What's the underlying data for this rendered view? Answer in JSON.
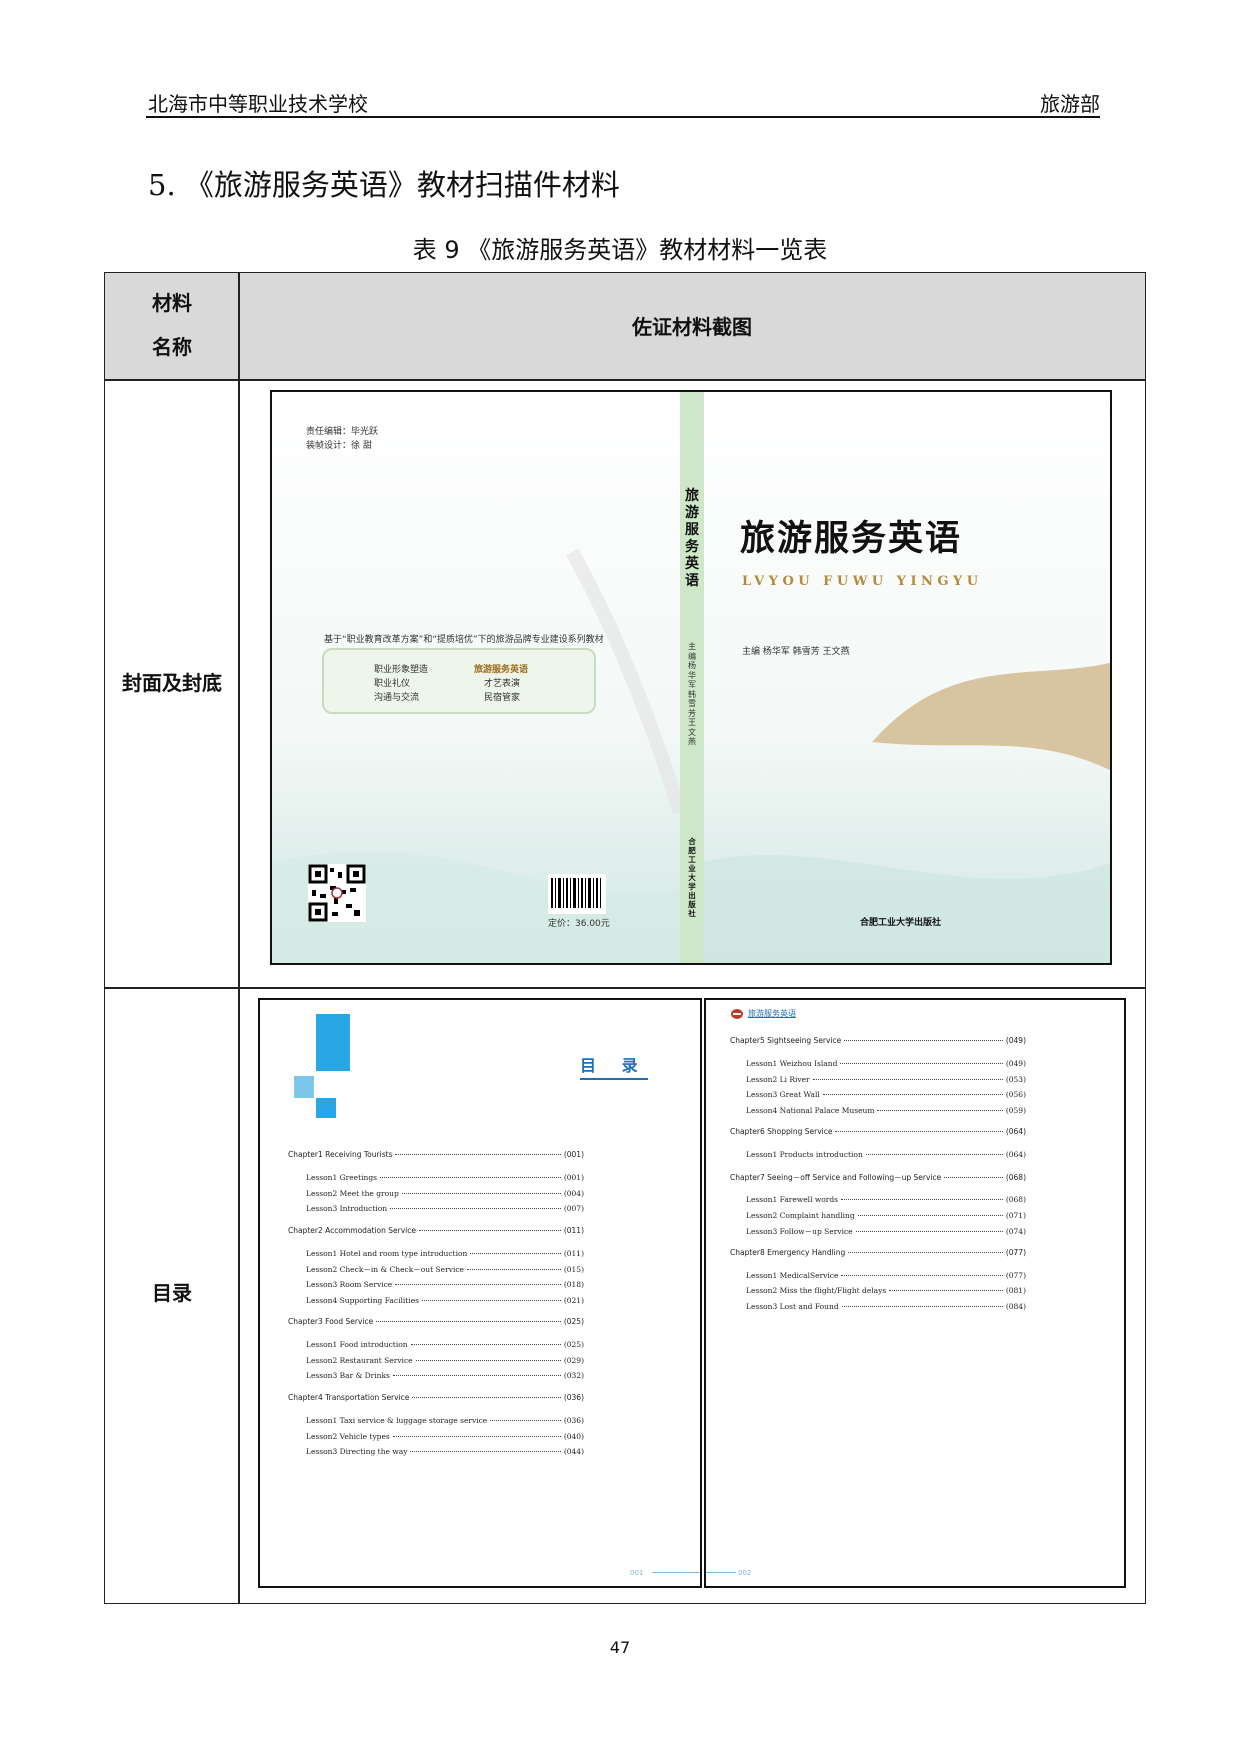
{
  "header": {
    "school": "北海市中等职业技术学校",
    "department": "旅游部"
  },
  "section_heading": "5. 《旅游服务英语》教材扫描件材料",
  "table_caption": "表 9 《旅游服务英语》教材材料一览表",
  "table": {
    "header_col1_line1": "材料",
    "header_col1_line2": "名称",
    "header_col2": "佐证材料截图",
    "rows": [
      {
        "name": "封面及封底"
      },
      {
        "name": "目录"
      }
    ]
  },
  "cover": {
    "back": {
      "editor": "责任编辑：毕光跃",
      "designer": "装帧设计：徐  甜",
      "series_banner": "基于“职业教育改革方案”和“提质培优”下的旅游品牌专业建设系列教材",
      "series_items": [
        "职业形象塑造",
        "旅游服务英语",
        "职业礼仪",
        "才艺表演",
        "沟通与交流",
        "民宿管家"
      ],
      "price": "定价：36.00元"
    },
    "spine": {
      "title": "旅游服务英语",
      "editors": "主编 杨华军 韩雪芳 王文燕",
      "publisher": "合肥工业大学出版社"
    },
    "front": {
      "title": "旅游服务英语",
      "pinyin": "LVYOU FUWU YINGYU",
      "editors": "主编  杨华军  韩雪芳  王文燕",
      "publisher": "合肥工业大学出版社"
    }
  },
  "toc": {
    "title": "目  录",
    "left_page_number": "001",
    "right_page_number": "002",
    "right_header": "旅游服务英语",
    "left": [
      {
        "type": "chapter",
        "text": "Chapter1   Receiving Tourists",
        "page": "(001)"
      },
      {
        "type": "lesson",
        "text": "Lesson1   Greetings",
        "page": "(001)"
      },
      {
        "type": "lesson",
        "text": "Lesson2   Meet the group",
        "page": "(004)"
      },
      {
        "type": "lesson",
        "text": "Lesson3   Introduction",
        "page": "(007)"
      },
      {
        "type": "chapter",
        "text": "Chapter2   Accommodation Service",
        "page": "(011)"
      },
      {
        "type": "lesson",
        "text": "Lesson1   Hotel and room type introduction",
        "page": "(011)"
      },
      {
        "type": "lesson",
        "text": "Lesson2   Check－in & Check－out Service",
        "page": "(015)"
      },
      {
        "type": "lesson",
        "text": "Lesson3   Room Service",
        "page": "(018)"
      },
      {
        "type": "lesson",
        "text": "Lesson4   Supporting Facilities",
        "page": "(021)"
      },
      {
        "type": "chapter",
        "text": "Chapter3   Food Service",
        "page": "(025)"
      },
      {
        "type": "lesson",
        "text": "Lesson1   Food introduction",
        "page": "(025)"
      },
      {
        "type": "lesson",
        "text": "Lesson2   Restaurant Service",
        "page": "(029)"
      },
      {
        "type": "lesson",
        "text": "Lesson3   Bar & Drinks",
        "page": "(032)"
      },
      {
        "type": "chapter",
        "text": "Chapter4   Transportation Service",
        "page": "(036)"
      },
      {
        "type": "lesson",
        "text": "Lesson1   Taxi service & luggage storage service",
        "page": "(036)"
      },
      {
        "type": "lesson",
        "text": "Lesson2   Vehicle types",
        "page": "(040)"
      },
      {
        "type": "lesson",
        "text": "Lesson3   Directing the way",
        "page": "(044)"
      }
    ],
    "right": [
      {
        "type": "chapter",
        "text": "Chapter5   Sightseeing Service",
        "page": "(049)"
      },
      {
        "type": "lesson",
        "text": "Lesson1   Weizhou Island",
        "page": "(049)"
      },
      {
        "type": "lesson",
        "text": "Lesson2   Li River",
        "page": "(053)"
      },
      {
        "type": "lesson",
        "text": "Lesson3   Great Wall",
        "page": "(056)"
      },
      {
        "type": "lesson",
        "text": "Lesson4   National Palace Museum",
        "page": "(059)"
      },
      {
        "type": "chapter",
        "text": "Chapter6   Shopping Service",
        "page": "(064)"
      },
      {
        "type": "lesson",
        "text": "Lesson1   Products introduction",
        "page": "(064)"
      },
      {
        "type": "chapter",
        "text": "Chapter7   Seeing－off Service and Following－up Service",
        "page": "(068)"
      },
      {
        "type": "lesson",
        "text": "Lesson1   Farewell words",
        "page": "(068)"
      },
      {
        "type": "lesson",
        "text": "Lesson2   Complaint handling",
        "page": "(071)"
      },
      {
        "type": "lesson",
        "text": "Lesson3   Follow－up Service",
        "page": "(074)"
      },
      {
        "type": "chapter",
        "text": "Chapter8   Emergency Handling",
        "page": "(077)"
      },
      {
        "type": "lesson",
        "text": "Lesson1   MedicalService",
        "page": "(077)"
      },
      {
        "type": "lesson",
        "text": "Lesson2   Miss the flight/Flight delays",
        "page": "(081)"
      },
      {
        "type": "lesson",
        "text": "Lesson3   Lost and Found",
        "page": "(084)"
      }
    ]
  },
  "page_number": "47"
}
